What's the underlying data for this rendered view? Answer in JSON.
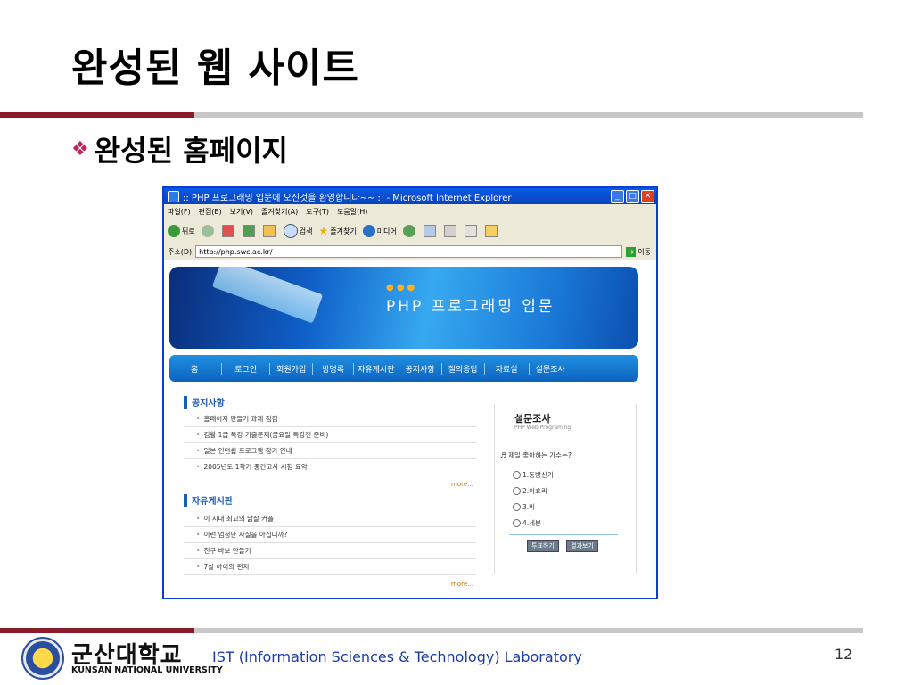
{
  "slide": {
    "title": "완성된 웹 사이트",
    "bullet": "완성된 홈페이지",
    "page_number": "12"
  },
  "browser": {
    "title": ":: PHP 프로그래밍 입문에 오신것을 환영합니다~~ :: - Microsoft Internet Explorer",
    "menu": [
      "파일(F)",
      "편집(E)",
      "보기(V)",
      "즐겨찾기(A)",
      "도구(T)",
      "도움말(H)"
    ],
    "toolbar": {
      "back": "뒤로",
      "search": "검색",
      "favorites": "즐겨찾기",
      "media": "미디어"
    },
    "address_label": "주소(D)",
    "url": "http://php.swc.ac.kr/",
    "go_label": "이동"
  },
  "site": {
    "banner_title": "PHP 프로그래밍 입문",
    "nav": [
      "홈",
      "로그인",
      "회원가입",
      "방명록",
      "자유게시판",
      "공지사항",
      "질의응답",
      "자료실",
      "설문조사"
    ],
    "notice": {
      "heading": "공지사항",
      "items": [
        "홈페이지 만들기 과제 점검",
        "컴활 1급 특강 기출문제(금요일 특강전 준비)",
        "일본 인턴쉽 프로그램 참가 안내",
        "2005년도 1학기 중간고사 시험 요약"
      ],
      "more": "more..."
    },
    "board": {
      "heading": "자유게시판",
      "items": [
        "이 시대 최고의 닭살 커플",
        "이런 엄청난 사실을 아십니까?",
        "친구 바보 만들기",
        "7살 아이의 편지"
      ],
      "more": "more..."
    },
    "poll": {
      "title": "설문조사",
      "subtitle": "PHP Web Programing",
      "question": "♬ 제일 좋아하는 가수는?",
      "options": [
        "1.동방신기",
        "2.이효리",
        "3.비",
        "4.세븐"
      ],
      "vote_button": "투표하기",
      "result_button": "결과보기"
    }
  },
  "footer": {
    "university_korean": "군산대학교",
    "university_english": "KUNSAN NATIONAL UNIVERSITY",
    "lab": "IST (Information Sciences & Technology) Laboratory"
  },
  "colors": {
    "accent_maroon": "#8b1a2b",
    "rule_gray": "#c8c8c8",
    "ie_blue": "#0a3fcf",
    "nav_blue": "#1f8fe0",
    "diamond": "#c0245e"
  }
}
